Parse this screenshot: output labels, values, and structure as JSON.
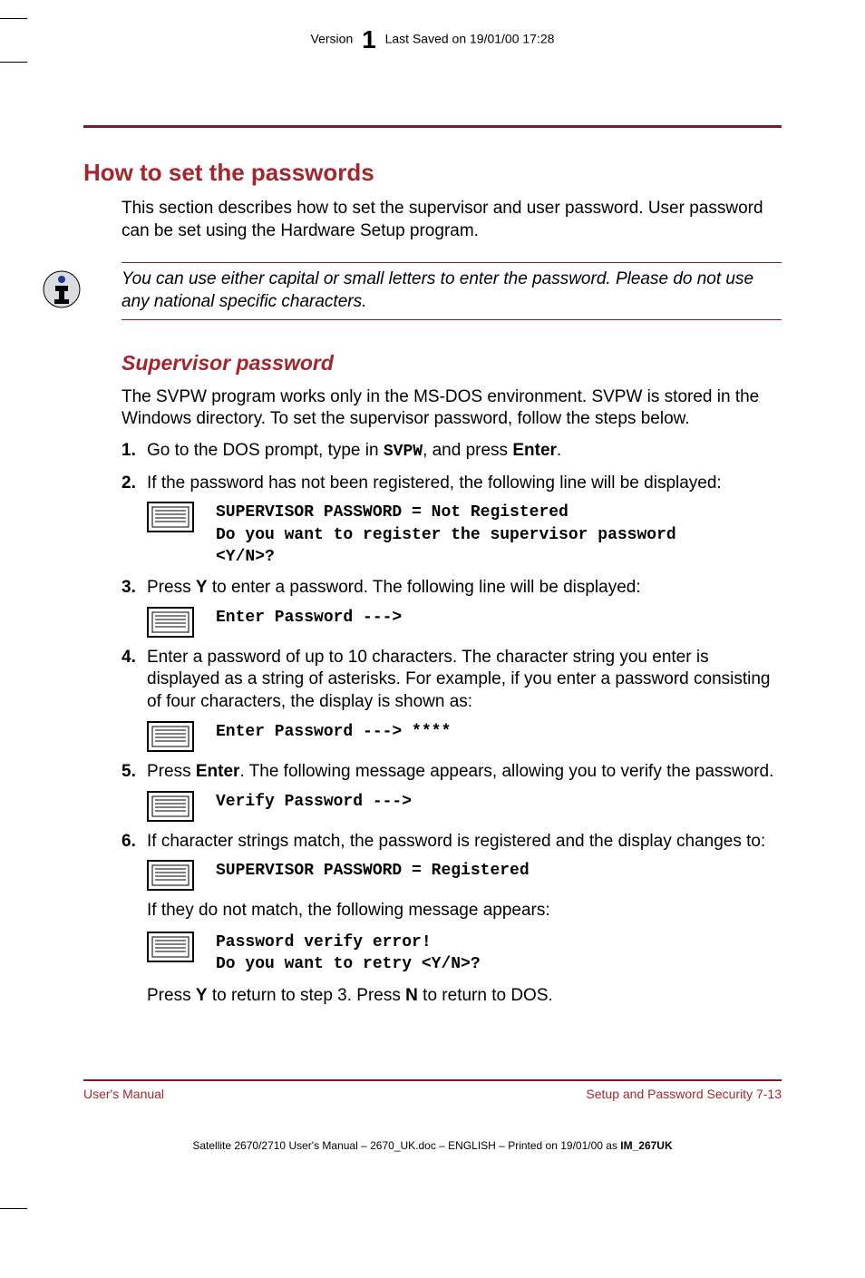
{
  "header": {
    "version_label": "Version",
    "version_num": "1",
    "saved": "Last Saved on 19/01/00 17:28"
  },
  "title": "How to set the passwords",
  "intro": "This section describes how to set the supervisor and user password. User password can be set using the Hardware Setup program.",
  "note": "You can use either capital or small letters to enter the password. Please do not use any national specific characters.",
  "subhead": "Supervisor password",
  "sv_intro": "The SVPW program works only in the MS-DOS environment. SVPW is stored in the Windows directory. To set the supervisor password, follow the steps below.",
  "steps": {
    "s1": {
      "num": "1.",
      "pre": "Go to the DOS prompt, type in ",
      "cmd": "SVPW",
      "mid": ", and press ",
      "key": "Enter",
      "post": "."
    },
    "s2": {
      "num": "2.",
      "text": "If the password has not been registered, the following line will be displayed:",
      "screen": "SUPERVISOR PASSWORD = Not Registered\nDo you want to register the supervisor password\n<Y/N>?"
    },
    "s3": {
      "num": "3.",
      "pre": "Press ",
      "key": "Y",
      "post": " to enter a password. The following line will be displayed:",
      "screen": "Enter Password --->"
    },
    "s4": {
      "num": "4.",
      "text": "Enter a password of up to 10 characters. The character string you enter is displayed as a string of asterisks. For example, if you enter a password consisting of four characters, the display is shown as:",
      "screen": "Enter Password ---> ****"
    },
    "s5": {
      "num": "5.",
      "pre": "Press ",
      "key": "Enter",
      "post": ". The following message appears, allowing you to verify the password.",
      "screen": "Verify Password --->"
    },
    "s6": {
      "num": "6.",
      "text": "If character strings match, the password is registered and the display changes to:",
      "screen1": "SUPERVISOR PASSWORD = Registered",
      "mismatch": "If they do not match, the following message appears:",
      "screen2": "Password verify error!\nDo you want to retry <Y/N>?",
      "final_pre": "Press ",
      "final_k1": "Y",
      "final_mid": " to return to step 3. Press ",
      "final_k2": "N",
      "final_post": " to return to DOS."
    }
  },
  "footer": {
    "left": "User's Manual",
    "right": "Setup and Password Security  7-13"
  },
  "printline": {
    "a": "Satellite 2670/2710 User's Manual  – 2670_UK.doc – ENGLISH – Printed on 19/01/00 as ",
    "b": "IM_267UK"
  }
}
